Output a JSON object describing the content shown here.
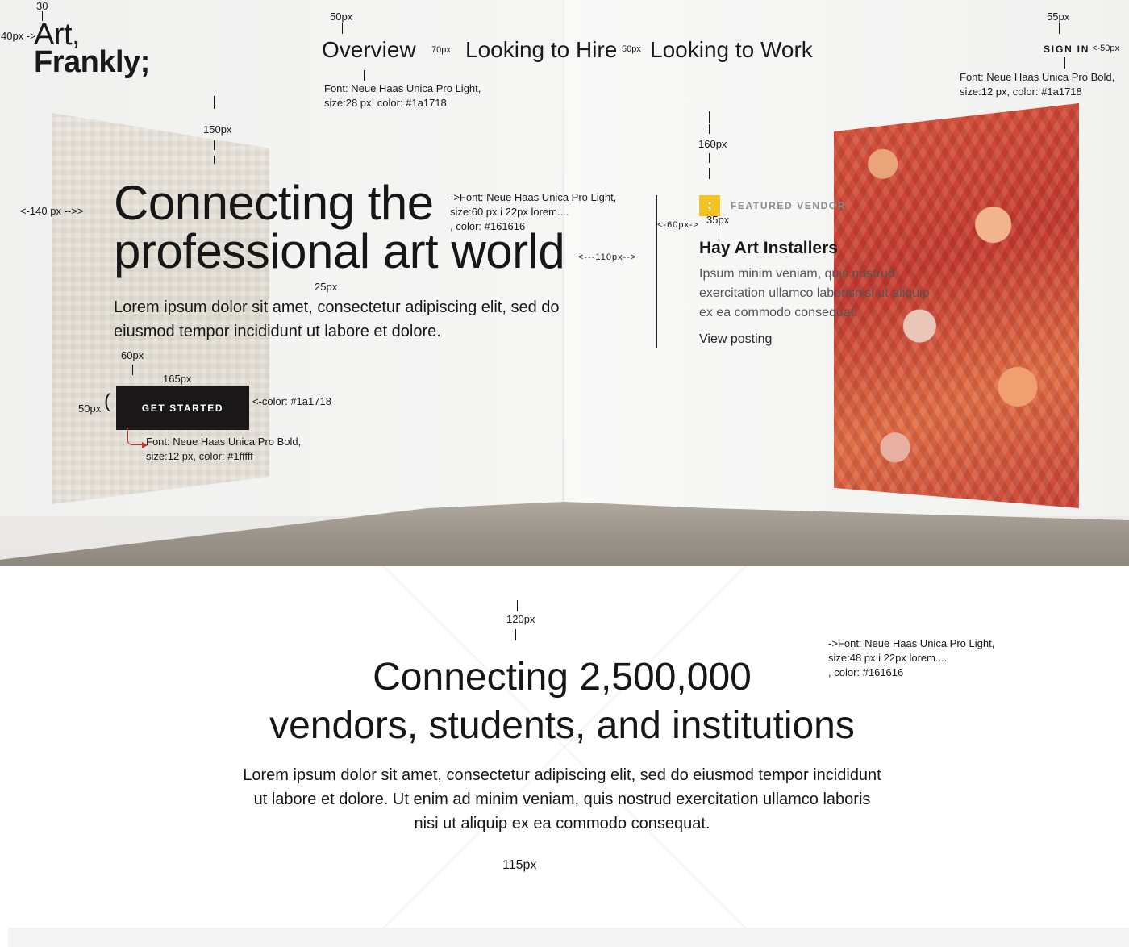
{
  "header": {
    "logo_line1": "Art,",
    "logo_line2": "Frankly;",
    "nav": [
      "Overview",
      "Looking to Hire",
      "Looking to Work"
    ],
    "signin_label": "SIGN IN"
  },
  "hero": {
    "title": "Connecting the professional art world",
    "subtitle": "Lorem ipsum dolor sit amet, consectetur adipiscing elit, sed do eiusmod tempor incididunt ut labore et dolore.",
    "cta_label": "GET STARTED"
  },
  "featured": {
    "eyebrow": "FEATURED VENDOR",
    "badge_glyph": ";",
    "name": "Hay Art Installers",
    "description": "Ipsum minim veniam, quis nostrud exercitation ullamco laborisnisi ut aliquip ex ea commodo consequat.",
    "link_label": "View posting"
  },
  "stats": {
    "title_line1": "Connecting 2,500,000",
    "title_line2": "vendors, students, and institutions",
    "body": "Lorem ipsum dolor sit amet, consectetur adipiscing elit, sed do eiusmod tempor incididunt ut labore et dolore. Ut enim ad minim veniam, quis nostrud exercitation ullamco laboris nisi ut aliquip ex ea commodo consequat."
  },
  "annotations": {
    "a30": "30",
    "a40": "40px ->",
    "a50_nav": "50px",
    "a70": "70px",
    "a50_gap": "50px",
    "a55": "55px",
    "a50_right": "<-50px",
    "font_nav_1": "Font: Neue Haas Unica Pro Light,",
    "font_nav_2": "size:28 px, color: #1a1718",
    "font_signin_1": "Font: Neue Haas Unica Pro Bold,",
    "font_signin_2": "size:12 px, color: #1a1718",
    "a150": "150px",
    "a160": "160px",
    "a140": "<-140 px -->>",
    "font_hero_1": "->Font: Neue Haas Unica Pro Light,",
    "font_hero_2": "size:60 px i 22px lorem....",
    "font_hero_3": ", color: #161616",
    "a60_vendor": "<-60px->",
    "a35": "35px",
    "a110": "<---110px-->",
    "a25": "25px",
    "a60_btn": "60px",
    "a165": "165px",
    "a50_btn": "50px",
    "paren": "(",
    "color_btn": "<-color: #1a1718",
    "font_btn_1": "Font: Neue Haas Unica Pro Bold,",
    "font_btn_2": "size:12 px, color: #1fffff",
    "a120": "120px",
    "font_stat_1": "->Font: Neue Haas Unica Pro Light,",
    "font_stat_2": "size:48 px i 22px lorem....",
    "font_stat_3": ", color: #161616",
    "a115": "115px"
  },
  "colors": {
    "text_dark": "#1a1718",
    "text_body": "#161616",
    "badge_yellow": "#f2c321",
    "button_bg": "#1a1718",
    "arrow_red": "#c0342f"
  }
}
